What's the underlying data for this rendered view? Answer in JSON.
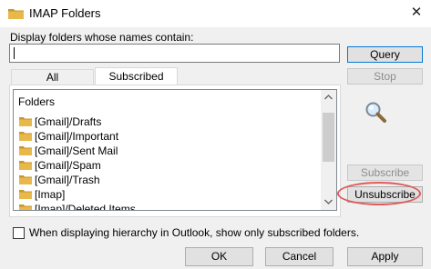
{
  "window": {
    "title": "IMAP Folders",
    "close_glyph": "✕"
  },
  "search": {
    "label": "Display folders whose names contain:",
    "value": ""
  },
  "buttons": {
    "query": "Query",
    "stop": "Stop",
    "subscribe": "Subscribe",
    "unsubscribe": "Unsubscribe",
    "ok": "OK",
    "cancel": "Cancel",
    "apply": "Apply"
  },
  "tabs": [
    {
      "label": "All",
      "active": false
    },
    {
      "label": "Subscribed",
      "active": true
    }
  ],
  "list": {
    "header": "Folders",
    "items": [
      "[Gmail]/Drafts",
      "[Gmail]/Important",
      "[Gmail]/Sent Mail",
      "[Gmail]/Spam",
      "[Gmail]/Trash",
      "[Imap]",
      "[Imap]/Deleted Items"
    ]
  },
  "option": {
    "label": "When displaying hierarchy in Outlook, show only subscribed folders.",
    "checked": false
  },
  "colors": {
    "folder": "#e8b84a",
    "folder_dark": "#c9962c",
    "highlight": "#e05a5a",
    "focus_border": "#0078d7"
  },
  "icons": {
    "title": "folder-icon",
    "search": "magnifier-icon",
    "scroll_up": "chevron-up-icon",
    "scroll_down": "chevron-down-icon"
  }
}
